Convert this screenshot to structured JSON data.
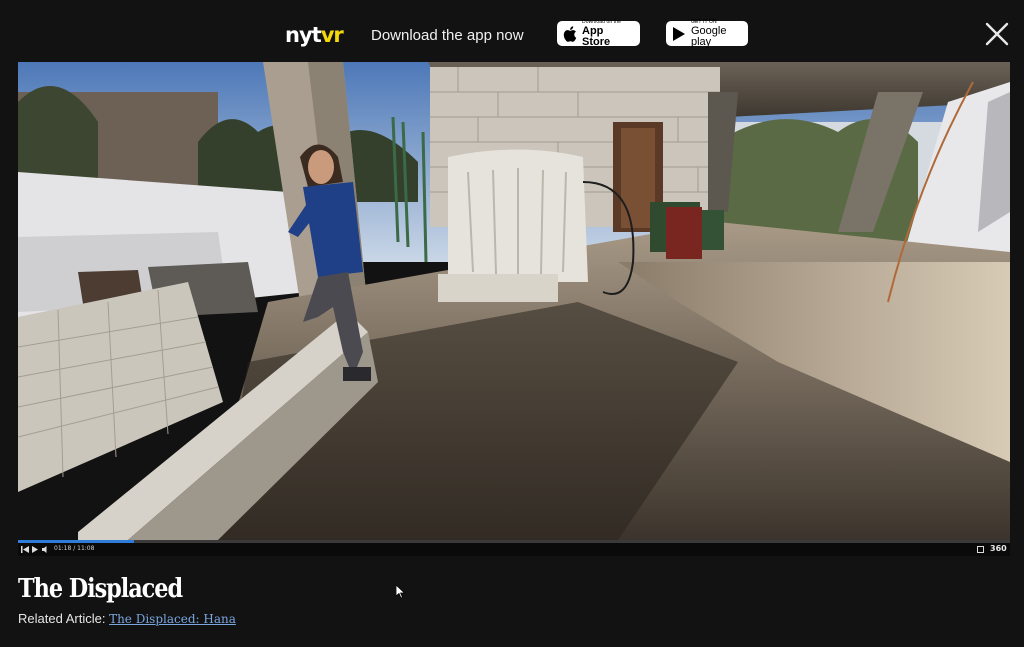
{
  "promo": {
    "logo_nyt": "nyt",
    "logo_vr": "vr",
    "text": "Download the app now",
    "app_store": {
      "small": "Download on the",
      "big": "App Store",
      "icon": "apple-icon"
    },
    "google_play": {
      "small": "GET IT ON",
      "big": "Google play",
      "icon": "play-icon"
    },
    "close_icon": "close-icon"
  },
  "player": {
    "current_time": "01:18",
    "duration": "11:08",
    "time_text": "01:18 / 11:08",
    "progress": 0.117,
    "badge": "360",
    "accent_color": "#2f7bd8",
    "icons": [
      "skip-back-icon",
      "play-icon",
      "volume-icon",
      "fullscreen-icon"
    ]
  },
  "article": {
    "title": "The Displaced",
    "related_label": "Related Article:",
    "related_link": "The Displaced: Hana",
    "link_color": "#7aa7e0"
  },
  "colors": {
    "background": "#121212",
    "logo_accent": "#f5d80a"
  }
}
